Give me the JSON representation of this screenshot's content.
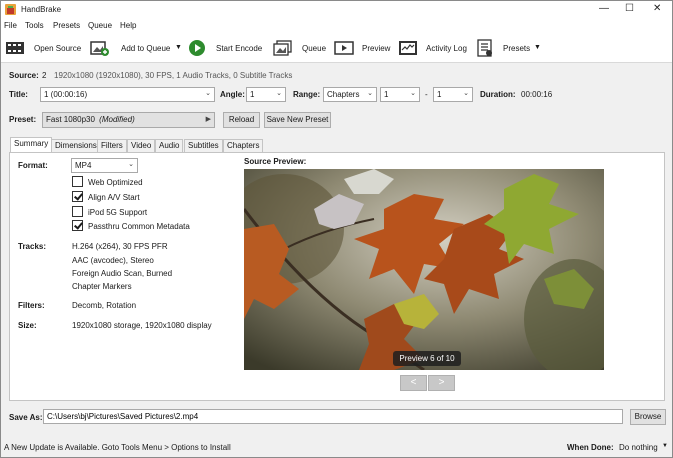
{
  "window": {
    "title": "HandBrake"
  },
  "menu": [
    "File",
    "Tools",
    "Presets",
    "Queue",
    "Help"
  ],
  "toolbar": {
    "open_source": "Open Source",
    "add_to_queue": "Add to Queue",
    "start_encode": "Start Encode",
    "queue": "Queue",
    "preview": "Preview",
    "activity_log": "Activity Log",
    "presets": "Presets"
  },
  "source": {
    "label": "Source:",
    "count": "2",
    "info": "1920x1080 (1920x1080), 30 FPS, 1 Audio Tracks, 0 Subtitle Tracks"
  },
  "title_row": {
    "title_label": "Title:",
    "title_value": "1 (00:00:16)",
    "angle_label": "Angle:",
    "angle_value": "1",
    "range_label": "Range:",
    "range_type": "Chapters",
    "range_start": "1",
    "range_sep": "-",
    "range_end": "1",
    "duration_label": "Duration:",
    "duration_value": "00:00:16"
  },
  "preset_row": {
    "label": "Preset:",
    "value": "Fast 1080p30",
    "modified": "(Modified)",
    "reload": "Reload",
    "save_new": "Save New Preset"
  },
  "tabs": [
    "Summary",
    "Dimensions",
    "Filters",
    "Video",
    "Audio",
    "Subtitles",
    "Chapters"
  ],
  "summary": {
    "format_label": "Format:",
    "format_value": "MP4",
    "options": [
      {
        "label": "Web Optimized",
        "checked": false
      },
      {
        "label": "Align A/V Start",
        "checked": true
      },
      {
        "label": "iPod 5G Support",
        "checked": false
      },
      {
        "label": "Passthru Common Metadata",
        "checked": true
      }
    ],
    "tracks_label": "Tracks:",
    "tracks": [
      "H.264 (x264), 30 FPS PFR",
      "AAC (avcodec), Stereo",
      "Foreign Audio Scan, Burned",
      "Chapter Markers"
    ],
    "filters_label": "Filters:",
    "filters_value": "Decomb, Rotation",
    "size_label": "Size:",
    "size_value": "1920x1080 storage, 1920x1080 display"
  },
  "source_preview": {
    "label": "Source Preview:",
    "overlay": "Preview 6 of 10",
    "prev": "<",
    "next": ">"
  },
  "save_as": {
    "label": "Save As:",
    "path": "C:\\Users\\bj\\Pictures\\Saved Pictures\\2.mp4",
    "browse": "Browse"
  },
  "status": {
    "message": "A New Update is Available. Goto Tools Menu > Options to Install",
    "when_done_label": "When Done:",
    "when_done_value": "Do nothing"
  },
  "colors": {
    "accent_green": "#2e8b2e",
    "window_bg": "#f0f0f0",
    "leaf_orange": "#b8531c"
  }
}
